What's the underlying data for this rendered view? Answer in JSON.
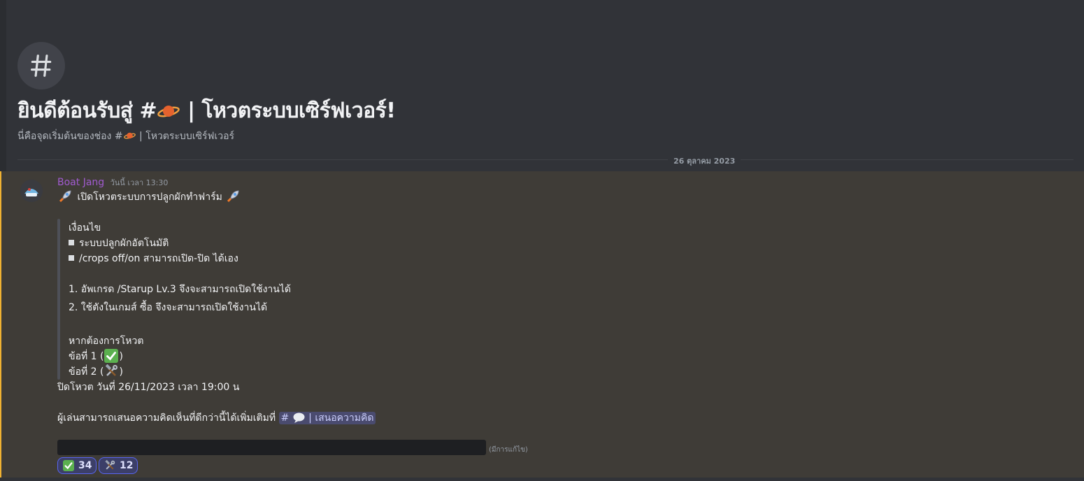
{
  "welcome": {
    "title_prefix": "ยินดีต้อนรับสู่ #",
    "title_suffix": " | โหวตระบบเซิร์ฟเวอร์!",
    "subtitle_prefix": "นี่คือจุดเริ่มต้นของช่อง #",
    "subtitle_suffix": " | โหวตระบบเซิร์ฟเวอร์"
  },
  "divider": {
    "date": "26 ตุลาคม 2023"
  },
  "message": {
    "author": "Boat Jang",
    "timestamp": "วันนี้ เวลา 13:30",
    "headline": " เปิดโหวตระบบการปลูกผักทำฟาร์ม ",
    "quote": {
      "condition_title": "เงื่อนไข",
      "bullets": [
        "ระบบปลูกผักอัตโนมัติ",
        "/crops off/on สามารถเปิด-ปิด ได้เอง"
      ],
      "numbered": [
        "1. อัพเกรด /Starup Lv.3 จึงจะสามารถเปิดใช้งานได้",
        "2. ใช้ตังในเกมส์ ซื้อ จึงจะสามารถเปิดใช้งานได้"
      ],
      "vote_title": "หากต้องการโหวต",
      "option1": "ข้อที่ 1 (",
      "option2": "ข้อที่ 2 (",
      "close_paren": ")"
    },
    "closing": "ปิดโหวต วันที่ 26/11/2023 เวลา 19:00 น",
    "suggest_prefix": "ผู้เล่นสามารถเสนอความคิดเห็นที่ดีกว่านี้ได้เพิ่มเติมที่ ",
    "suggest_channel_hash": "#",
    "suggest_channel_name": " | เสนอความคิด",
    "edited_label": "(มีการแก้ไข)"
  },
  "reactions": [
    {
      "emoji": "check-mark-icon",
      "count": "34"
    },
    {
      "emoji": "hammer-wrench-icon",
      "count": "12"
    }
  ],
  "colors": {
    "background": "#313338",
    "message_highlight": "#3f3c37",
    "highlight_border": "#f0b232",
    "author": "#a15bd0",
    "mention_bg": "#4a4b6f",
    "reaction_border": "#5865f2"
  }
}
